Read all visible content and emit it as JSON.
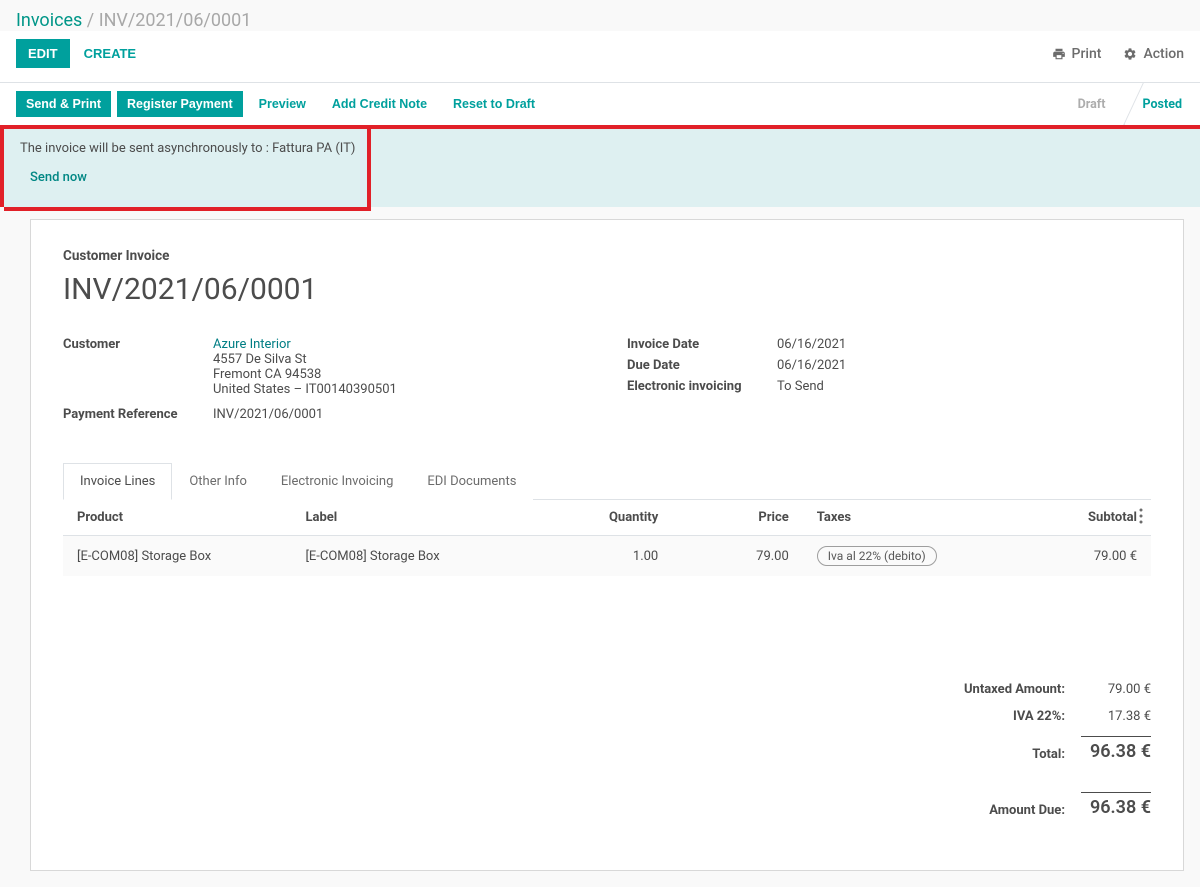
{
  "breadcrumb": {
    "root": "Invoices",
    "sep": " / ",
    "current": "INV/2021/06/0001"
  },
  "toolbar": {
    "edit": "Edit",
    "create": "Create",
    "print": "Print",
    "action": "Action"
  },
  "actionbar": {
    "send_print": "Send & Print",
    "register_payment": "Register Payment",
    "preview": "Preview",
    "add_credit_note": "Add Credit Note",
    "reset_to_draft": "Reset to Draft"
  },
  "status": {
    "draft": "Draft",
    "posted": "Posted"
  },
  "banner": {
    "message": "The invoice will be sent asynchronously to : Fattura PA (IT)",
    "action": "Send now"
  },
  "sheet": {
    "subtitle": "Customer Invoice",
    "title": "INV/2021/06/0001",
    "customer_label": "Customer",
    "customer_name": "Azure Interior",
    "customer_addr1": "4557 De Silva St",
    "customer_addr2": "Fremont CA 94538",
    "customer_addr3": "United States – IT00140390501",
    "payref_label": "Payment Reference",
    "payref_value": "INV/2021/06/0001",
    "invdate_label": "Invoice Date",
    "invdate_value": "06/16/2021",
    "duedate_label": "Due Date",
    "duedate_value": "06/16/2021",
    "einv_label": "Electronic invoicing",
    "einv_value": "To Send"
  },
  "tabs": {
    "lines": "Invoice Lines",
    "other": "Other Info",
    "einv": "Electronic Invoicing",
    "edi": "EDI Documents"
  },
  "table": {
    "h_product": "Product",
    "h_label": "Label",
    "h_qty": "Quantity",
    "h_price": "Price",
    "h_taxes": "Taxes",
    "h_subtotal": "Subtotal",
    "r0_product": "[E-COM08] Storage Box",
    "r0_label": "[E-COM08] Storage Box",
    "r0_qty": "1.00",
    "r0_price": "79.00",
    "r0_tax": "Iva al 22% (debito)",
    "r0_subtotal": "79.00 €"
  },
  "totals": {
    "untaxed_label": "Untaxed Amount:",
    "untaxed_val": "79.00 €",
    "iva_label": "IVA 22%:",
    "iva_val": "17.38 €",
    "total_label": "Total:",
    "total_val": "96.38 €",
    "due_label": "Amount Due:",
    "due_val": "96.38 €"
  }
}
